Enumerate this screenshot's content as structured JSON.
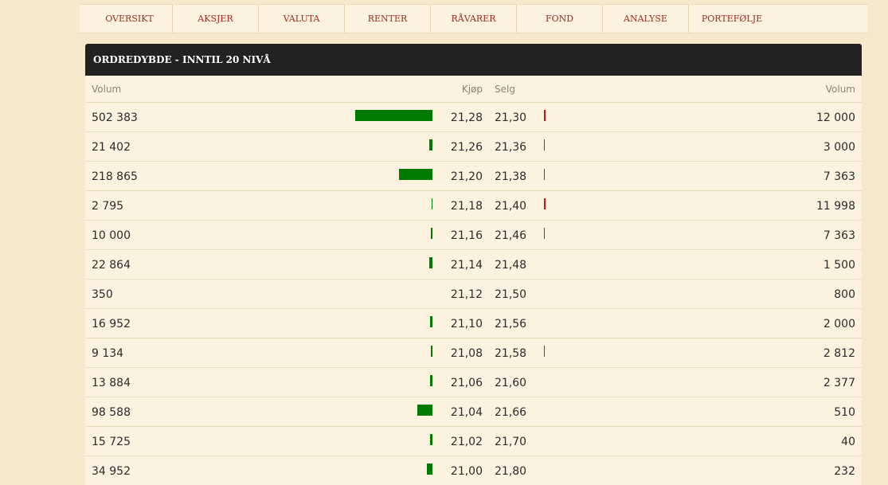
{
  "nav": {
    "items": [
      {
        "label": "OVERSIKT"
      },
      {
        "label": "AKSJER"
      },
      {
        "label": "VALUTA"
      },
      {
        "label": "RENTER"
      },
      {
        "label": "RÅVARER"
      },
      {
        "label": "FOND"
      },
      {
        "label": "ANALYSE"
      },
      {
        "label": "PORTEFØLJE"
      }
    ]
  },
  "panel": {
    "title": "ORDREDYBDE - INNTIL 20 NIVÅ",
    "headers": {
      "volume_left": "Volum",
      "bid": "Kjøp",
      "ask": "Selg",
      "volume_right": "Volum"
    }
  },
  "colors": {
    "bid_bar": "#007a00",
    "ask_bar": "#c4121a",
    "nav_text": "#9a2b22"
  },
  "orderbook": {
    "rows": [
      {
        "bid_volume": "502 383",
        "bid": "21,28",
        "ask": "21,30",
        "ask_volume": "12 000",
        "bid_bar": 1.0,
        "ask_bar": 0.02
      },
      {
        "bid_volume": "21 402",
        "bid": "21,26",
        "ask": "21,36",
        "ask_volume": "3 000",
        "bid_bar": 0.04,
        "ask_bar": 0.01
      },
      {
        "bid_volume": "218 865",
        "bid": "21,20",
        "ask": "21,38",
        "ask_volume": "7 363",
        "bid_bar": 0.435,
        "ask_bar": 0.01
      },
      {
        "bid_volume": "2 795",
        "bid": "21,18",
        "ask": "21,40",
        "ask_volume": "11 998",
        "bid_bar": 0.006,
        "ask_bar": 0.02
      },
      {
        "bid_volume": "10 000",
        "bid": "21,16",
        "ask": "21,46",
        "ask_volume": "7 363",
        "bid_bar": 0.02,
        "ask_bar": 0.01
      },
      {
        "bid_volume": "22 864",
        "bid": "21,14",
        "ask": "21,48",
        "ask_volume": "1 500",
        "bid_bar": 0.045,
        "ask_bar": 0
      },
      {
        "bid_volume": "350",
        "bid": "21,12",
        "ask": "21,50",
        "ask_volume": "800",
        "bid_bar": 0,
        "ask_bar": 0
      },
      {
        "bid_volume": "16 952",
        "bid": "21,10",
        "ask": "21,56",
        "ask_volume": "2 000",
        "bid_bar": 0.034,
        "ask_bar": 0
      },
      {
        "bid_volume": "9 134",
        "bid": "21,08",
        "ask": "21,58",
        "ask_volume": "2 812",
        "bid_bar": 0.018,
        "ask_bar": 0.01
      },
      {
        "bid_volume": "13 884",
        "bid": "21,06",
        "ask": "21,60",
        "ask_volume": "2 377",
        "bid_bar": 0.028,
        "ask_bar": 0
      },
      {
        "bid_volume": "98 588",
        "bid": "21,04",
        "ask": "21,66",
        "ask_volume": "510",
        "bid_bar": 0.196,
        "ask_bar": 0
      },
      {
        "bid_volume": "15 725",
        "bid": "21,02",
        "ask": "21,70",
        "ask_volume": "40",
        "bid_bar": 0.031,
        "ask_bar": 0
      },
      {
        "bid_volume": "34 952",
        "bid": "21,00",
        "ask": "21,80",
        "ask_volume": "232",
        "bid_bar": 0.07,
        "ask_bar": 0
      }
    ]
  }
}
